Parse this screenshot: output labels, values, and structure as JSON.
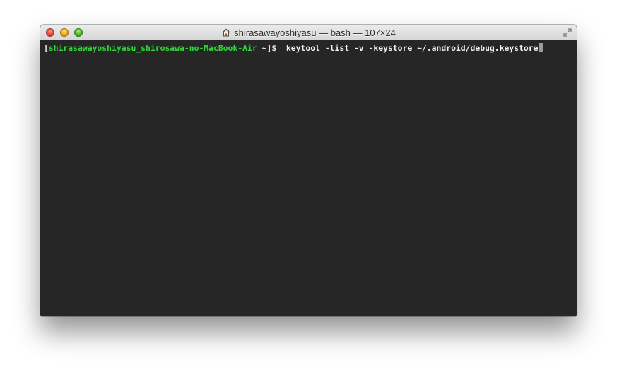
{
  "window": {
    "title": "shirasawayoshiyasu — bash — 107×24",
    "icons": {
      "home": "home-icon",
      "fullscreen": "fullscreen-icon"
    },
    "colors": {
      "terminal_bg": "#262626",
      "prompt_user": "#2fd93a",
      "text": "#f0f0f0"
    }
  },
  "terminal": {
    "prompt_open": "[",
    "prompt_user_host": "shirasawayoshiyasu_shirosawa-no-MacBook-Air",
    "prompt_close": " ~]$ ",
    "command": " keytool -list -v -keystore ~/.android/debug.keystore"
  }
}
